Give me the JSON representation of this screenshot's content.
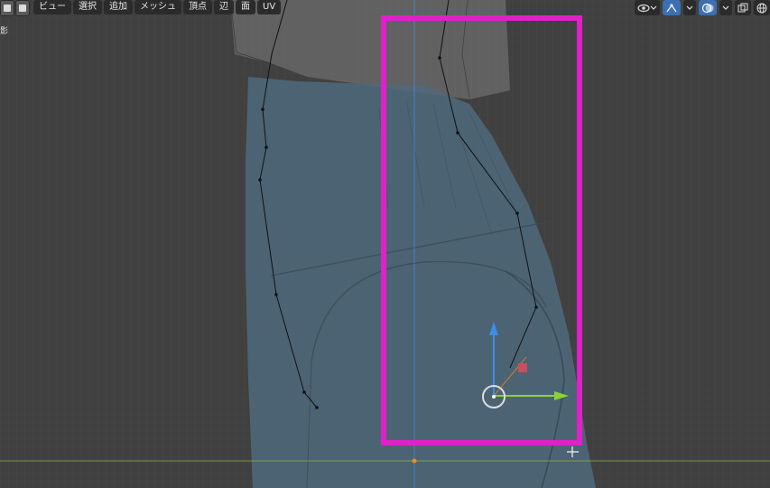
{
  "menu": {
    "items": [
      "ビュー",
      "選択",
      "追加",
      "メッシュ",
      "頂点",
      "辺",
      "面",
      "UV"
    ]
  },
  "side_label": "影",
  "icons": {
    "visibility": "eye-icon",
    "gizmo": "gizmo-icon",
    "overlay": "overlay-icon",
    "xray": "xray-icon",
    "shading": "wireframe-sphere-icon",
    "dropdown": "chevron-down-icon"
  },
  "colors": {
    "viewport_bg": "#3f3f3f",
    "selection_box": "#e020c8",
    "gizmo_y_axis": "#8ad23a",
    "gizmo_z_axis": "#3a8fe6",
    "mesh_edge": "#111111",
    "active_tool": "#3d6fb3"
  }
}
